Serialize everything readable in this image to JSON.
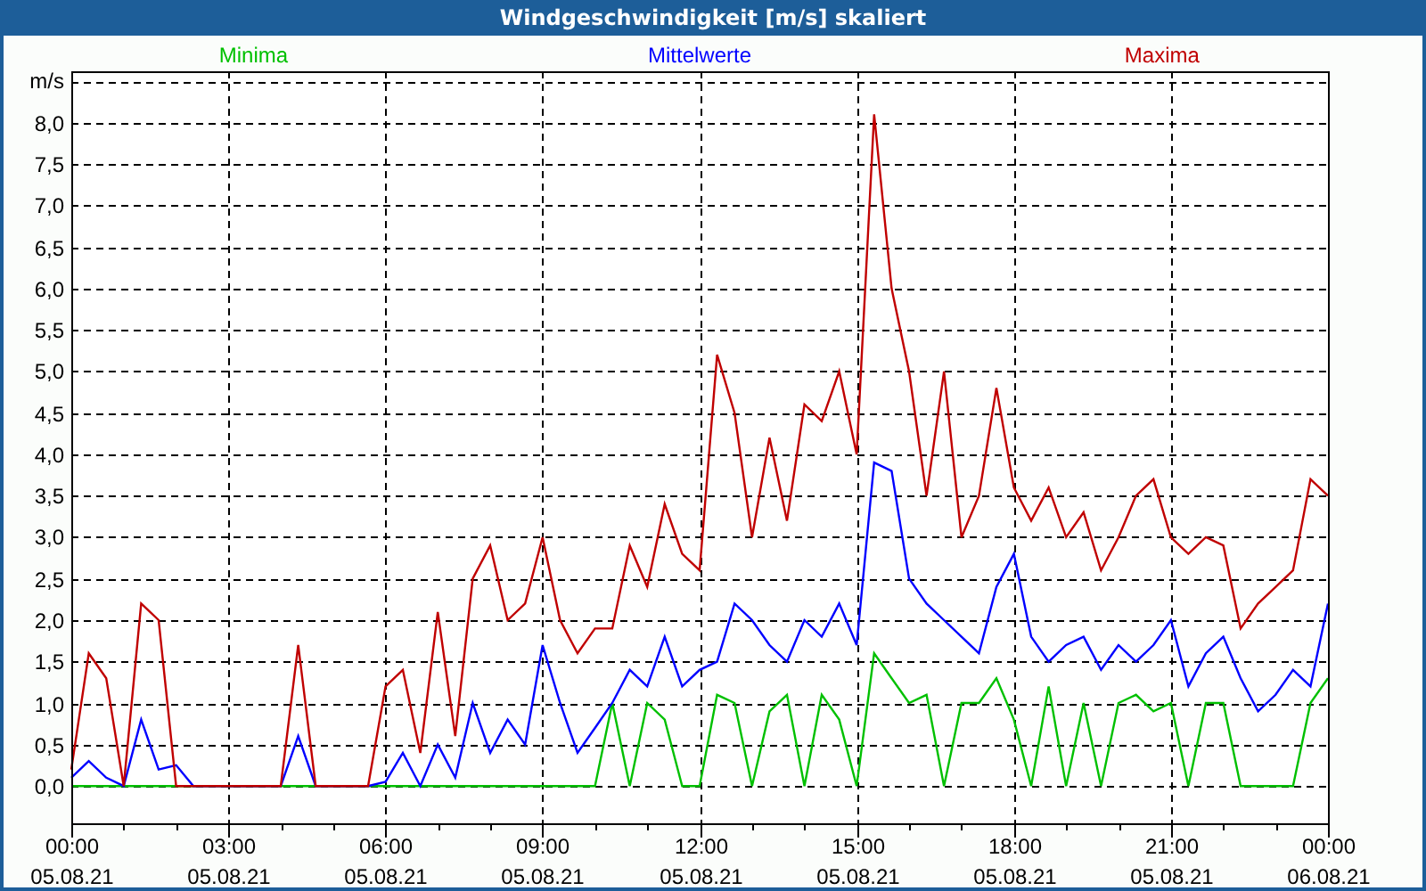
{
  "chart_data": {
    "type": "line",
    "grid": true,
    "title": "Windgeschwindigkeit [m/s] skaliert",
    "ylabel": "m/s",
    "categories": [
      "00:00\n05.08.21",
      null,
      null,
      null,
      null,
      null,
      null,
      null,
      null,
      "03:00\n05.08.21",
      null,
      null,
      null,
      null,
      null,
      null,
      null,
      null,
      "06:00\n05.08.21",
      null,
      null,
      null,
      null,
      null,
      null,
      null,
      null,
      "09:00\n05.08.21",
      null,
      null,
      null,
      null,
      null,
      null,
      null,
      null,
      "12:00\n05.08.21",
      null,
      null,
      null,
      null,
      null,
      null,
      null,
      null,
      "15:00\n05.08.21",
      null,
      null,
      null,
      null,
      null,
      null,
      null,
      null,
      "18:00\n05.08.21",
      null,
      null,
      null,
      null,
      null,
      null,
      null,
      null,
      "21:00\n05.08.21",
      null,
      null,
      null,
      null,
      null,
      null,
      null,
      null,
      "00:00\n06.08.21"
    ],
    "series": [
      {
        "name": "Minima",
        "color": "#00c000",
        "values": [
          0,
          0,
          0,
          0,
          0,
          0,
          0,
          0,
          0,
          0,
          0,
          0,
          0,
          0,
          0,
          0,
          0,
          0,
          0,
          0,
          0,
          0,
          0,
          0,
          0,
          0,
          0,
          0,
          0,
          0,
          0,
          1.0,
          0,
          1.0,
          0.8,
          0,
          0,
          1.1,
          1.0,
          0,
          0.9,
          1.1,
          0,
          1.1,
          0.8,
          0,
          1.6,
          1.3,
          1.0,
          1.1,
          0,
          1.0,
          1.0,
          1.3,
          0.8,
          0,
          1.2,
          0,
          1.0,
          0,
          1.0,
          1.1,
          0.9,
          1.0,
          0,
          1.0,
          1.0,
          0,
          0,
          0,
          0,
          1.0,
          1.3
        ]
      },
      {
        "name": "Mittelwerte",
        "color": "#0000ff",
        "values": [
          0.1,
          0.3,
          0.1,
          0,
          0.8,
          0.2,
          0.25,
          0,
          0,
          0,
          0,
          0,
          0,
          0.6,
          0,
          0,
          0,
          0,
          0.05,
          0.4,
          0,
          0.5,
          0.1,
          1.0,
          0.4,
          0.8,
          0.5,
          1.7,
          1.0,
          0.4,
          0.7,
          1.0,
          1.4,
          1.2,
          1.8,
          1.2,
          1.4,
          1.5,
          2.2,
          2.0,
          1.7,
          1.5,
          2.0,
          1.8,
          2.2,
          1.7,
          3.9,
          3.8,
          2.5,
          2.2,
          2.0,
          1.8,
          1.6,
          2.4,
          2.8,
          1.8,
          1.5,
          1.7,
          1.8,
          1.4,
          1.7,
          1.5,
          1.7,
          2.0,
          1.2,
          1.6,
          1.8,
          1.3,
          0.9,
          1.1,
          1.4,
          1.2,
          2.2
        ]
      },
      {
        "name": "Maxima",
        "color": "#c00000",
        "values": [
          0.2,
          1.6,
          1.3,
          0,
          2.2,
          2.0,
          0,
          0,
          0,
          0,
          0,
          0,
          0,
          1.7,
          0,
          0,
          0,
          0,
          1.2,
          1.4,
          0.4,
          2.1,
          0.6,
          2.5,
          2.9,
          2.0,
          2.2,
          3.0,
          2.0,
          1.6,
          1.9,
          1.9,
          2.9,
          2.4,
          3.4,
          2.8,
          2.6,
          5.2,
          4.5,
          3.0,
          4.2,
          3.2,
          4.6,
          4.4,
          5.0,
          4.0,
          8.1,
          6.0,
          5.0,
          3.5,
          5.0,
          3.0,
          3.5,
          4.8,
          3.6,
          3.2,
          3.6,
          3.0,
          3.3,
          2.6,
          3.0,
          3.5,
          3.7,
          3.0,
          2.8,
          3.0,
          2.9,
          1.9,
          2.2,
          2.4,
          2.6,
          3.7,
          3.5
        ]
      }
    ],
    "ylim": [
      -0.45,
      8.62
    ],
    "yticks": [
      {
        "value": 0,
        "label": "0,0"
      },
      {
        "value": 0.5,
        "label": "0,5"
      },
      {
        "value": 1,
        "label": "1,0"
      },
      {
        "value": 1.5,
        "label": "1,5"
      },
      {
        "value": 2,
        "label": "2,0"
      },
      {
        "value": 2.5,
        "label": "2,5"
      },
      {
        "value": 3,
        "label": "3,0"
      },
      {
        "value": 3.5,
        "label": "3,5"
      },
      {
        "value": 4,
        "label": "4,0"
      },
      {
        "value": 4.5,
        "label": "4,5"
      },
      {
        "value": 5,
        "label": "5,0"
      },
      {
        "value": 5.5,
        "label": "5,5"
      },
      {
        "value": 6,
        "label": "6,0"
      },
      {
        "value": 6.5,
        "label": "6,5"
      },
      {
        "value": 7,
        "label": "7,0"
      },
      {
        "value": 7.5,
        "label": "7,5"
      },
      {
        "value": 8,
        "label": "8,0"
      }
    ]
  }
}
